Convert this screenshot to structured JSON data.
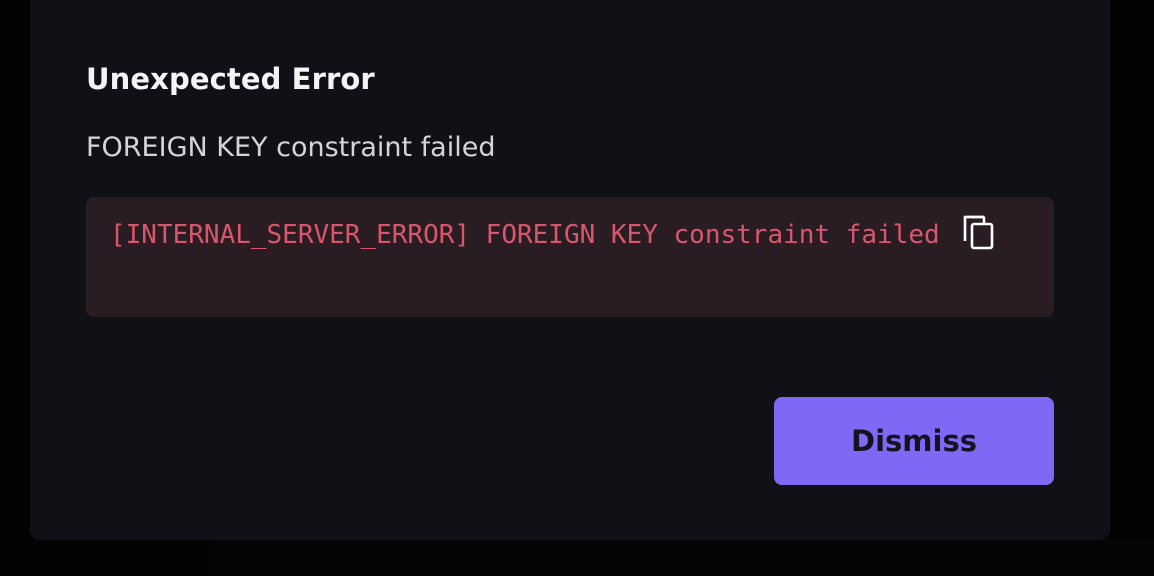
{
  "dialog": {
    "title": "Unexpected Error",
    "message": "FOREIGN KEY constraint failed",
    "error_detail": "[INTERNAL_SERVER_ERROR] FOREIGN KEY constraint failed",
    "copy_icon": "copy-icon",
    "dismiss_label": "Dismiss"
  },
  "colors": {
    "dialog_background": "#0f1117",
    "error_box_background": "#2a1c23",
    "error_text": "#d9566b",
    "accent": "#8068f5"
  }
}
